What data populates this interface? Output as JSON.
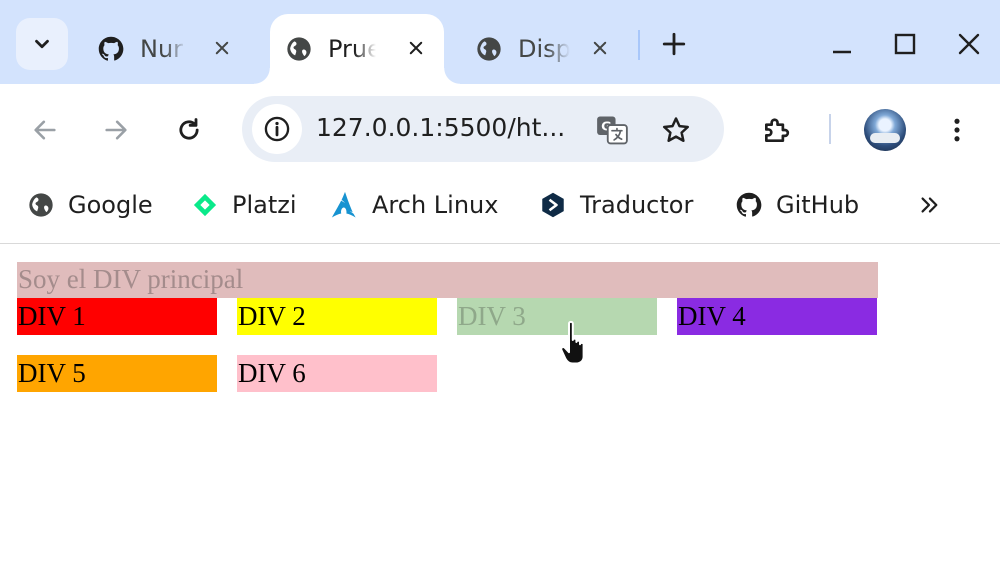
{
  "tabs": [
    {
      "label": "Nur",
      "icon": "github-icon",
      "active": false
    },
    {
      "label": "Prue",
      "icon": "globe-icon",
      "active": true
    },
    {
      "label": "Disp",
      "icon": "globe-icon",
      "active": false
    }
  ],
  "address_bar": {
    "url": "127.0.0.1:5500/ht..."
  },
  "bookmarks": [
    {
      "label": "Google",
      "icon": "globe-icon"
    },
    {
      "label": "Platzi",
      "icon": "platzi-icon"
    },
    {
      "label": "Arch Linux",
      "icon": "arch-linux-icon"
    },
    {
      "label": "Traductor",
      "icon": "traductor-icon"
    },
    {
      "label": "GitHub",
      "icon": "github-icon"
    }
  ],
  "page": {
    "principal": {
      "text": "Soy el DIV principal",
      "color": "#e0bcbc"
    },
    "divs": [
      {
        "text": "DIV 1",
        "color": "#ff0000"
      },
      {
        "text": "DIV 2",
        "color": "#ffff00"
      },
      {
        "text": "DIV 3",
        "color": "#b6d8b0"
      },
      {
        "text": "DIV 4",
        "color": "#8a2be2"
      },
      {
        "text": "DIV 5",
        "color": "#ffa500"
      },
      {
        "text": "DIV 6",
        "color": "#ffc0cb"
      }
    ]
  },
  "colors": {
    "tabstrip": "#d3e3fd",
    "omnibox": "#e9eef6"
  }
}
